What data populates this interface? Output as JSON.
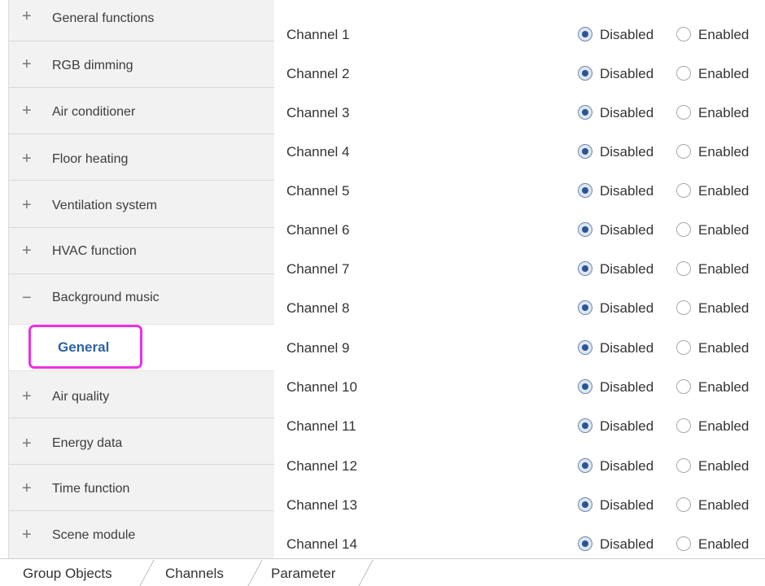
{
  "sidebar": {
    "items": [
      {
        "symbol": "+",
        "label": "General functions"
      },
      {
        "symbol": "+",
        "label": "RGB dimming"
      },
      {
        "symbol": "+",
        "label": "Air conditioner"
      },
      {
        "symbol": "+",
        "label": "Floor heating"
      },
      {
        "symbol": "+",
        "label": "Ventilation system"
      },
      {
        "symbol": "+",
        "label": "HVAC function"
      },
      {
        "symbol": "−",
        "label": "Background music"
      },
      {
        "symbol": "+",
        "label": "Air quality"
      },
      {
        "symbol": "+",
        "label": "Energy data"
      },
      {
        "symbol": "+",
        "label": "Time function"
      },
      {
        "symbol": "+",
        "label": "Scene module"
      }
    ],
    "selected_sub_item": "General"
  },
  "radio_labels": {
    "disabled": "Disabled",
    "enabled": "Enabled"
  },
  "channels": [
    {
      "label": "Channel 1",
      "value": "Disabled"
    },
    {
      "label": "Channel 2",
      "value": "Disabled"
    },
    {
      "label": "Channel 3",
      "value": "Disabled"
    },
    {
      "label": "Channel 4",
      "value": "Disabled"
    },
    {
      "label": "Channel 5",
      "value": "Disabled"
    },
    {
      "label": "Channel 6",
      "value": "Disabled"
    },
    {
      "label": "Channel 7",
      "value": "Disabled"
    },
    {
      "label": "Channel 8",
      "value": "Disabled"
    },
    {
      "label": "Channel 9",
      "value": "Disabled"
    },
    {
      "label": "Channel 10",
      "value": "Disabled"
    },
    {
      "label": "Channel 11",
      "value": "Disabled"
    },
    {
      "label": "Channel 12",
      "value": "Disabled"
    },
    {
      "label": "Channel 13",
      "value": "Disabled"
    },
    {
      "label": "Channel 14",
      "value": "Disabled"
    }
  ],
  "tabs": {
    "group_objects": "Group Objects",
    "channels": "Channels",
    "parameter": "Parameter",
    "active": "Parameter"
  },
  "colors": {
    "highlight_outline": "#ee2fe6",
    "selected_text": "#2a62a8",
    "radio_checked": "#2a5592"
  }
}
